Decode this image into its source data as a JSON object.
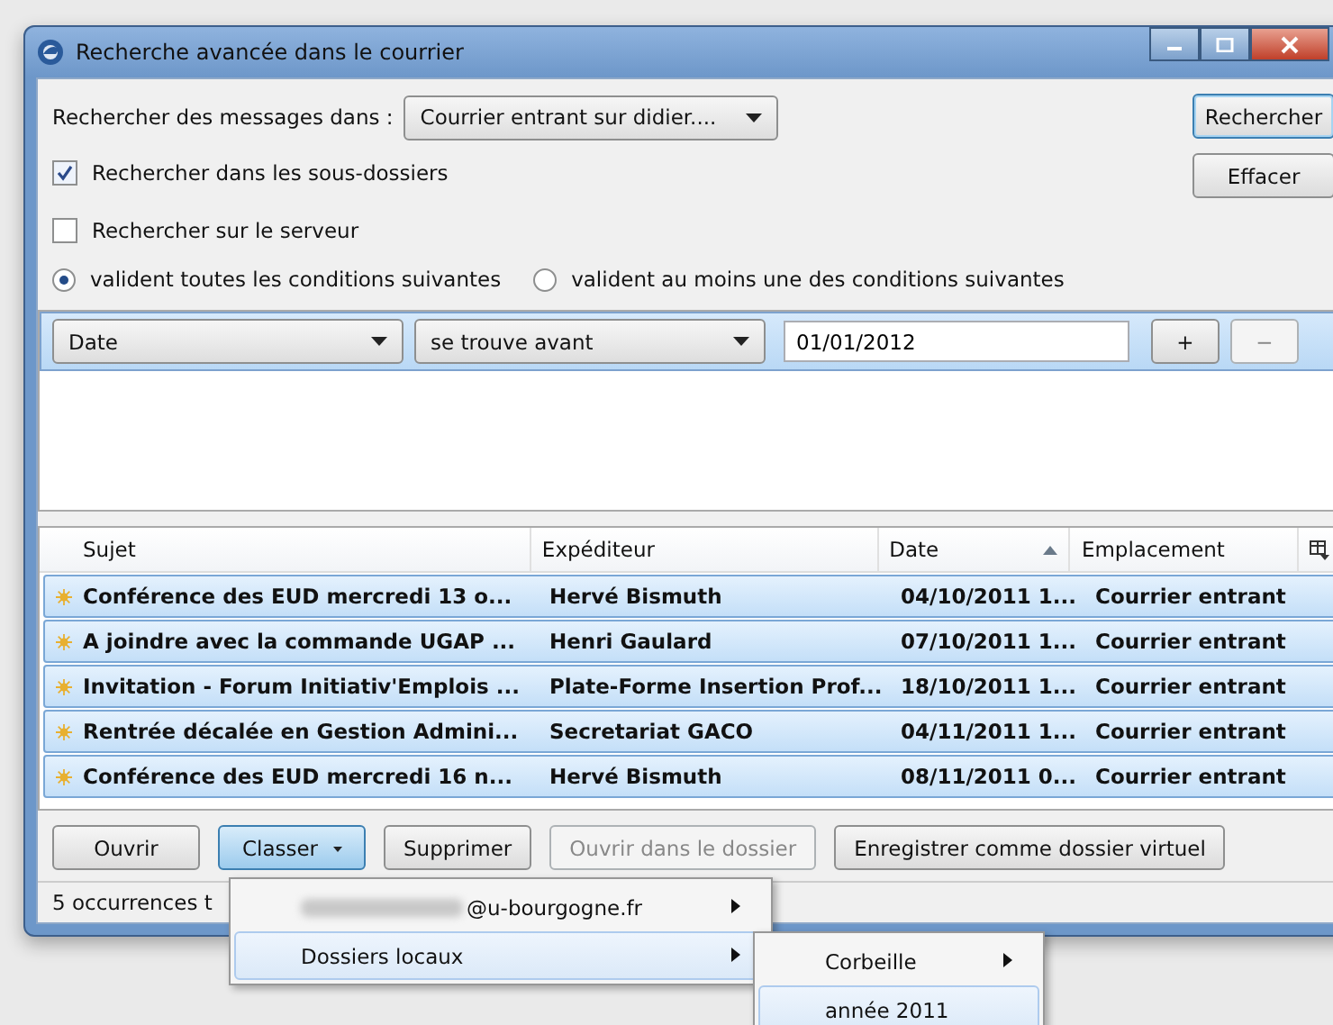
{
  "window": {
    "title": "Recherche avancée dans le courrier"
  },
  "search_in": {
    "label": "Rechercher des messages dans :",
    "value": "Courrier entrant sur didier...."
  },
  "actions": [
    {
      "label": "Rechercher",
      "default": true
    },
    {
      "label": "Effacer",
      "default": false
    }
  ],
  "checkboxes": [
    {
      "label": "Rechercher dans les sous-dossiers",
      "checked": true
    },
    {
      "label": "Rechercher sur le serveur",
      "checked": false
    }
  ],
  "match": [
    {
      "label": "valident toutes les conditions suivantes",
      "selected": true
    },
    {
      "label": "valident au moins une des conditions suivantes",
      "selected": false
    }
  ],
  "condition": {
    "field": "Date",
    "operator": "se trouve avant",
    "value": "01/01/2012",
    "add": "+",
    "remove": "−"
  },
  "table": {
    "columns": [
      {
        "label": "Sujet",
        "sorted": false
      },
      {
        "label": "Expéditeur",
        "sorted": false
      },
      {
        "label": "Date",
        "sorted": true
      },
      {
        "label": "Emplacement",
        "sorted": false
      }
    ],
    "rows": [
      {
        "subject": "Conférence des EUD mercredi 13 o...",
        "sender": "Hervé Bismuth",
        "date": "04/10/2011 1...",
        "location": "Courrier entrant",
        "selected": true,
        "unread": true
      },
      {
        "subject": "A joindre avec la commande UGAP ...",
        "sender": "Henri Gaulard",
        "date": "07/10/2011 1...",
        "location": "Courrier entrant",
        "selected": true,
        "unread": true
      },
      {
        "subject": "Invitation - Forum Initiativ'Emplois ...",
        "sender": "Plate-Forme Insertion Prof...",
        "date": "18/10/2011 1...",
        "location": "Courrier entrant",
        "selected": true,
        "unread": true
      },
      {
        "subject": "Rentrée décalée en Gestion Admini...",
        "sender": "Secretariat GACO",
        "date": "04/11/2011 1...",
        "location": "Courrier entrant",
        "selected": true,
        "unread": true
      },
      {
        "subject": "Conférence des EUD mercredi 16 n...",
        "sender": "Hervé Bismuth",
        "date": "08/11/2011 0...",
        "location": "Courrier entrant",
        "selected": true,
        "unread": true
      }
    ]
  },
  "buttons": [
    {
      "label": "Ouvrir",
      "disabled": false,
      "dropdown": false,
      "pressed": false
    },
    {
      "label": "Classer",
      "disabled": false,
      "dropdown": true,
      "pressed": true
    },
    {
      "label": "Supprimer",
      "disabled": false,
      "dropdown": false,
      "pressed": false
    },
    {
      "label": "Ouvrir dans le dossier",
      "disabled": true,
      "dropdown": false,
      "pressed": false
    },
    {
      "label": "Enregistrer comme dossier virtuel",
      "disabled": false,
      "dropdown": false,
      "pressed": false
    }
  ],
  "status_bar": "5 occurrences t",
  "menu": [
    {
      "label": "@u-bourgogne.fr",
      "blurred_prefix": true,
      "submenu": true,
      "selected": false
    },
    {
      "label": "Dossiers locaux",
      "blurred_prefix": false,
      "submenu": true,
      "selected": true
    }
  ],
  "submenu": [
    {
      "label": "Corbeille",
      "submenu": true,
      "selected": false
    },
    {
      "label": "année 2011",
      "submenu": false,
      "selected": true
    }
  ]
}
